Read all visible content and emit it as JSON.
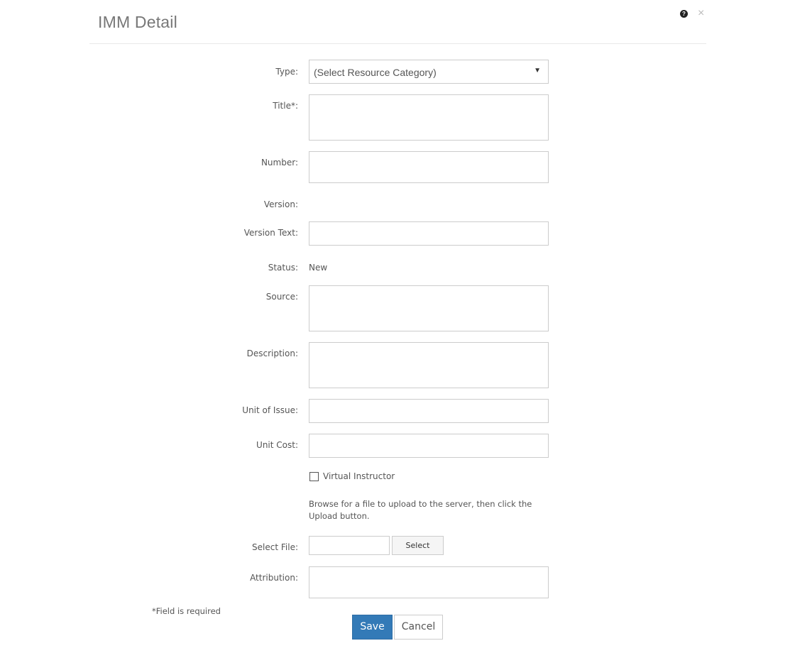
{
  "dialog": {
    "title": "IMM Detail",
    "help_icon": "question-circle-icon",
    "help_glyph": "?",
    "close_icon": "close-icon",
    "close_glyph": "×"
  },
  "form": {
    "type": {
      "label": "Type:",
      "selected": "(Select Resource Category)",
      "caret": "▼"
    },
    "title": {
      "label": "Title*:",
      "value": ""
    },
    "number": {
      "label": "Number:",
      "value": ""
    },
    "version": {
      "label": "Version:",
      "value": ""
    },
    "version_text": {
      "label": "Version Text:",
      "value": ""
    },
    "status": {
      "label": "Status:",
      "value": "New"
    },
    "source": {
      "label": "Source:",
      "value": ""
    },
    "description": {
      "label": "Description:",
      "value": ""
    },
    "unit_of_issue": {
      "label": "Unit of Issue:",
      "value": ""
    },
    "unit_cost": {
      "label": "Unit Cost:",
      "value": ""
    },
    "virtual_instructor": {
      "label": "Virtual Instructor",
      "checked": false
    },
    "upload_help": "Browse for a file to upload to the server, then click the Upload button.",
    "select_file": {
      "label": "Select File:",
      "value": "",
      "button": "Select"
    },
    "attribution": {
      "label": "Attribution:",
      "value": ""
    }
  },
  "footer": {
    "required_note": "*Field is required",
    "save_label": "Save",
    "cancel_label": "Cancel"
  },
  "colors": {
    "primary": "#337ab7",
    "border": "#cccccc",
    "text": "#555555"
  }
}
